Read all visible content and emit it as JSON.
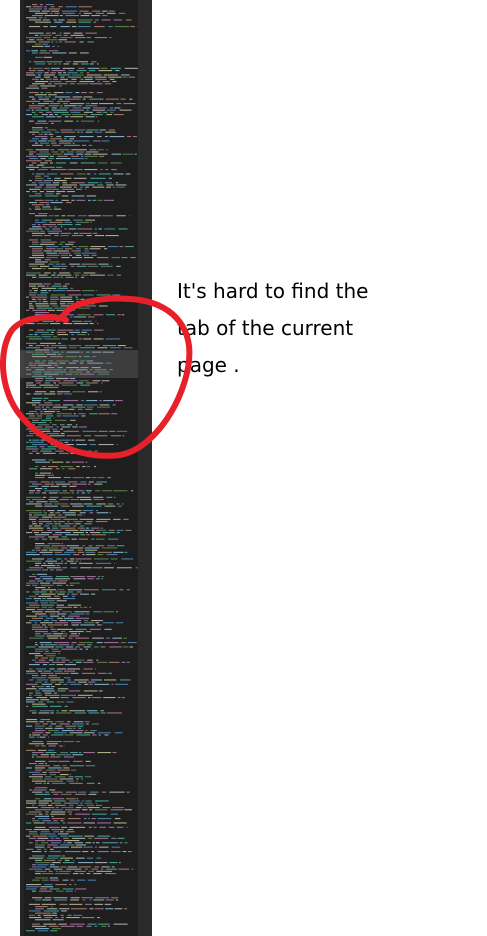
{
  "editor": {
    "panel": "minimap",
    "background_color": "#1e1e1e",
    "viewport_highlight_color": "#5a5a5a"
  },
  "annotation": {
    "lines": [
      "It's hard to find the",
      "tab of the current",
      "page ."
    ],
    "color": "#e8202a"
  }
}
